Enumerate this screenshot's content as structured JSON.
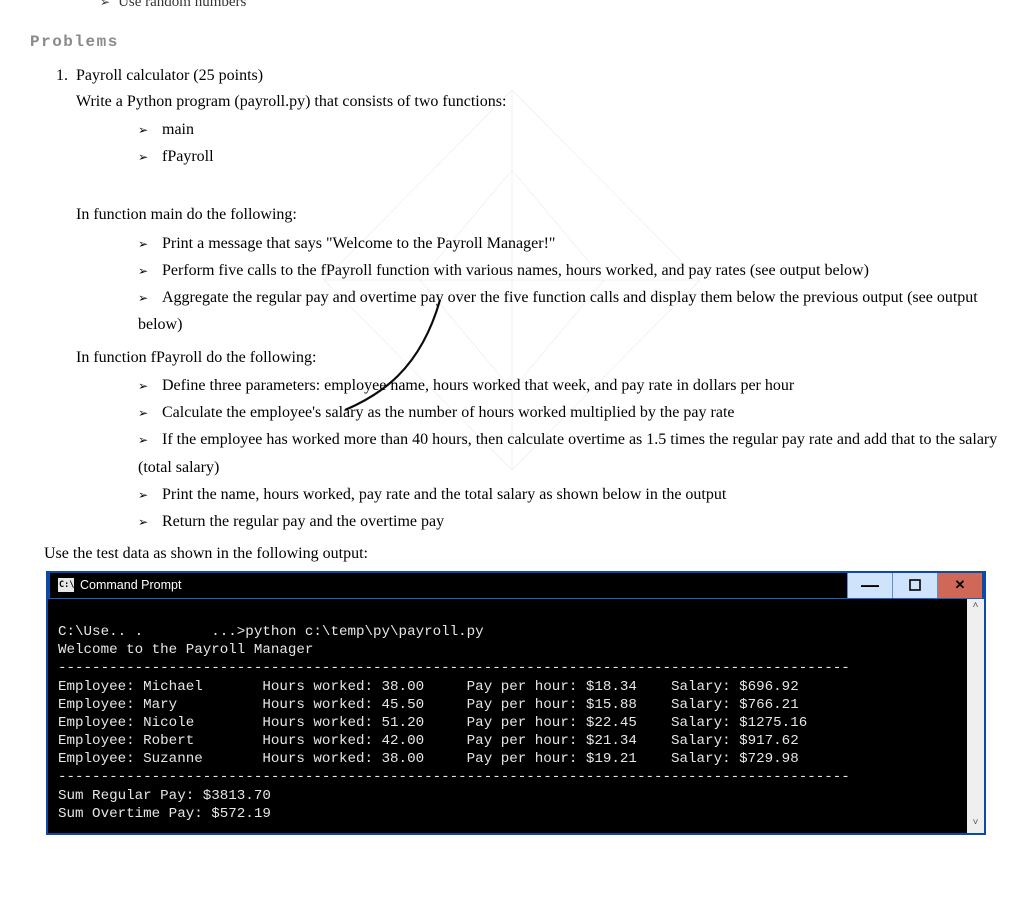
{
  "cutoff_bullet": "Use random numbers",
  "section_heading": "Problems",
  "problem": {
    "title": "Payroll calculator (25 points)",
    "intro": "Write a Python program (payroll.py) that consists of two functions:",
    "funcs": [
      "main",
      "fPayroll"
    ],
    "main_heading": "In function main do the following:",
    "main_items": [
      "Print a message that says \"Welcome to the Payroll Manager!\"",
      "Perform five calls to the fPayroll function with various names, hours worked, and pay rates (see output below)",
      "Aggregate the regular pay and overtime pay over the five function calls and display them below the previous output (see output below)"
    ],
    "fpay_heading": "In function fPayroll do the following:",
    "fpay_items": [
      "Define three parameters: employee name, hours worked that week, and pay rate in dollars per hour",
      "Calculate the employee's salary as the number of hours worked multiplied by the pay rate",
      "If the employee has worked more than 40 hours, then calculate overtime as 1.5 times the regular pay rate and add that to the salary (total salary)",
      "Print the name, hours worked, pay rate and the total salary as shown below in the output",
      "Return the regular pay and the overtime pay"
    ],
    "usetest": "Use the test data as shown in the following output:"
  },
  "cmd": {
    "title": "Command Prompt",
    "command_line": "C:\\Use.. .        ...>python c:\\temp\\py\\payroll.py",
    "welcome": "Welcome to the Payroll Manager",
    "sep": "---------------------------------------------------------------------------------------------",
    "rows": [
      {
        "emp": "Michael",
        "hours": "38.00",
        "rate": "$18.34",
        "sal": "$696.92"
      },
      {
        "emp": "Mary",
        "hours": "45.50",
        "rate": "$15.88",
        "sal": "$766.21"
      },
      {
        "emp": "Nicole",
        "hours": "51.20",
        "rate": "$22.45",
        "sal": "$1275.16"
      },
      {
        "emp": "Robert",
        "hours": "42.00",
        "rate": "$21.34",
        "sal": "$917.62"
      },
      {
        "emp": "Suzanne",
        "hours": "38.00",
        "rate": "$19.21",
        "sal": "$729.98"
      }
    ],
    "sum_reg": "Sum Regular Pay: $3813.70",
    "sum_over": "Sum Overtime Pay: $572.19"
  }
}
